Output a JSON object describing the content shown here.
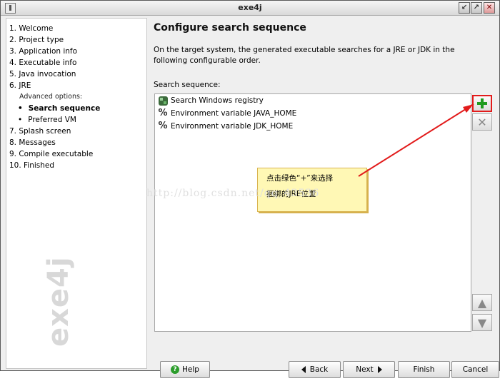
{
  "window": {
    "title": "exe4j"
  },
  "sidebar": {
    "steps": [
      {
        "label": "1. Welcome"
      },
      {
        "label": "2. Project type"
      },
      {
        "label": "3. Application info"
      },
      {
        "label": "4. Executable info"
      },
      {
        "label": "5. Java invocation"
      },
      {
        "label": "6. JRE"
      },
      {
        "label": "Advanced options:"
      },
      {
        "label": "Search sequence"
      },
      {
        "label": "Preferred VM"
      },
      {
        "label": "7. Splash screen"
      },
      {
        "label": "8. Messages"
      },
      {
        "label": "9. Compile executable"
      },
      {
        "label": "10. Finished"
      }
    ],
    "logo_text": "exe4j"
  },
  "main": {
    "title": "Configure search sequence",
    "description": "On the target system, the generated executable searches for a JRE or JDK in the following configurable order.",
    "sequence_label": "Search sequence:",
    "items": [
      {
        "label": "Search Windows registry",
        "icon": "registry-icon"
      },
      {
        "label": "Environment variable JAVA_HOME",
        "icon": "percent-icon"
      },
      {
        "label": "Environment variable JDK_HOME",
        "icon": "percent-icon"
      }
    ],
    "note": {
      "line1": "点击绿色“+”来选择",
      "line2": "捆绑的JRE位置"
    },
    "watermark_text": "http://blog.csdn.net/qq_43536"
  },
  "footer": {
    "help": "Help",
    "back": "Back",
    "next": "Next",
    "finish": "Finish",
    "cancel": "Cancel"
  },
  "colors": {
    "accent_red": "#e21b1b",
    "plus_green": "#1f9b1f",
    "note_yellow": "#fff8b5"
  }
}
